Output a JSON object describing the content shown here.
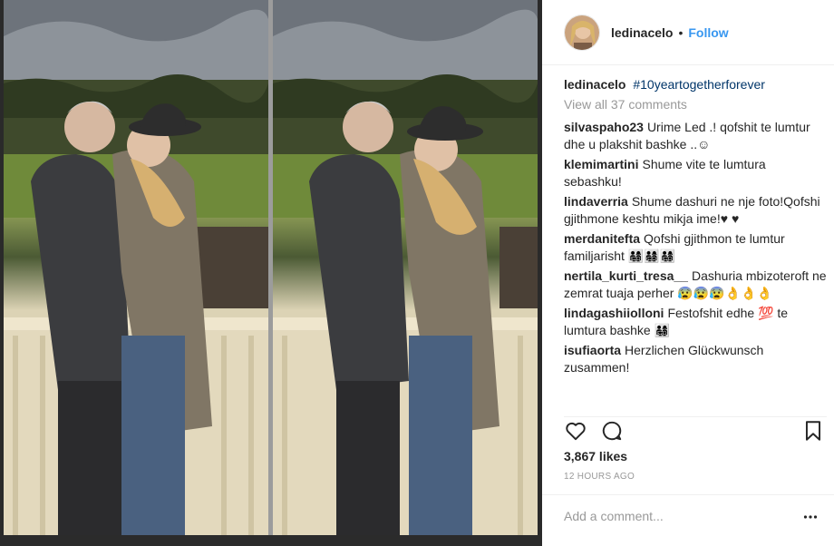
{
  "post": {
    "username": "ledinacelo",
    "follow_label": "Follow",
    "header_dot": "•",
    "caption": {
      "username": "ledinacelo",
      "hashtag": "#10yeartogetherforever"
    },
    "view_all": "View all 37 comments",
    "comments": [
      {
        "username": "silvaspaho23",
        "text": "Urime Led .! qofshit te lumtur dhe u plakshit bashke ..☺"
      },
      {
        "username": "klemimartini",
        "text": "Shume vite te lumtura sebashku!"
      },
      {
        "username": "lindaverria",
        "text": "Shume dashuri ne nje foto!Qofshi gjithmone keshtu mikja ime!♥ ♥"
      },
      {
        "username": "merdanitefta",
        "text": "Qofshi gjithmon te lumtur familjarisht 👨‍👩‍👧‍👦👨‍👩‍👧‍👦👨‍👩‍👧‍👦"
      },
      {
        "username": "nertila_kurti_tresa__",
        "text": "Dashuria mbizoteroft ne zemrat tuaja perher 😰😰😰👌👌👌"
      },
      {
        "username": "lindagashiiolloni",
        "text": "Festofshit edhe 💯 te lumtura bashke 👨‍👩‍👧‍👦"
      },
      {
        "username": "isufiaorta",
        "text": "Herzlichen Glückwunsch zusammen!"
      }
    ],
    "likes": "3,867 likes",
    "time": "12 HOURS AGO",
    "add_comment_placeholder": "Add a comment..."
  },
  "icons": {
    "like": "heart-icon",
    "comment": "speech-bubble-icon",
    "save": "bookmark-icon",
    "more": "ellipsis-icon"
  },
  "colors": {
    "link": "#3897f0",
    "hashtag": "#003569",
    "muted": "#999999",
    "text": "#262626"
  }
}
